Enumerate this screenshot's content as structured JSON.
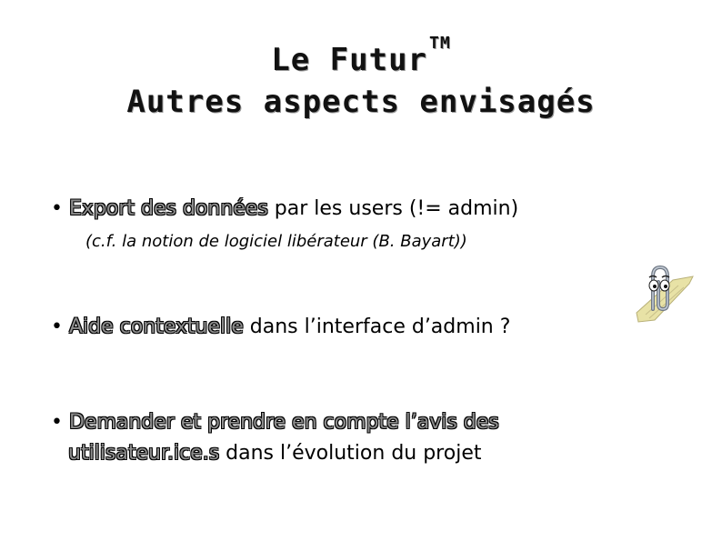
{
  "title": {
    "line1": "Le Futur",
    "trademark": "TM",
    "line2": "Autres aspects envisagés"
  },
  "bullets": [
    {
      "marker": "•",
      "highlight": "Export des données",
      "text": " par les users (!= admin)",
      "note": "(c.f. la notion de logiciel libérateur (B. Bayart))"
    },
    {
      "marker": "•",
      "highlight": " Aide contextuelle",
      "text": " dans l’interface d’admin ?"
    },
    {
      "marker": "•",
      "highlight": " Demander et prendre en compte l’avis des",
      "highlight2": "utilisateur.ice.s",
      "text": " dans l’évolution du projet"
    }
  ],
  "clippy": {
    "icon": "paperclip-assistant-icon"
  }
}
